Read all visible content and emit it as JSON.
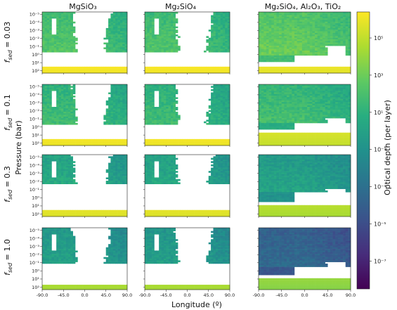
{
  "chart_data": {
    "type": "heatmap",
    "column_titles": [
      "MgSiO₃",
      "Mg₂SiO₄",
      "Mg₂SiO₄, Al₂O₃, TiO₂"
    ],
    "row_labels": [
      {
        "prefix": "f",
        "subscript": "sed",
        "suffix": " = 0.03"
      },
      {
        "prefix": "f",
        "subscript": "sed",
        "suffix": " = 0.1"
      },
      {
        "prefix": "f",
        "subscript": "sed",
        "suffix": " = 0.3"
      },
      {
        "prefix": "f",
        "subscript": "sed",
        "suffix": " = 1.0"
      }
    ],
    "xlabel": "Longitude (º)",
    "ylabel": "Pressure (bar)",
    "xlim": [
      -90,
      90
    ],
    "xticks": [
      "-90.0",
      "-45.0",
      "0.0",
      "45.0",
      "90.0"
    ],
    "ylim_log10": [
      -5.3,
      2.3
    ],
    "yticks": [
      "10⁻⁵",
      "10⁻⁴",
      "10⁻³",
      "10⁻²",
      "10⁻¹",
      "10⁰",
      "10¹",
      "10²"
    ],
    "colorbar": {
      "label": "Optical depth (per layer)",
      "scale": "log",
      "range_log10": [
        -8.5,
        6.4
      ],
      "ticks": [
        "10⁵",
        "10³",
        "10¹",
        "10⁻¹",
        "10⁻³",
        "10⁻⁵",
        "10⁻⁷"
      ],
      "colormap": "viridis"
    },
    "colormap_stops": [
      "#440154",
      "#472d7b",
      "#3b528b",
      "#2c728e",
      "#21918c",
      "#28ae80",
      "#5ec962",
      "#addc30",
      "#fde725"
    ],
    "panels": [
      {
        "row": 0,
        "col": 0,
        "upper_log_tau": 1.6,
        "bottom_log_tau": 6.3,
        "deep_band_log_p": [
          1.55,
          2.3
        ],
        "upper_cloud_bottom_log_p": -0.3,
        "vacant_nightside": true
      },
      {
        "row": 0,
        "col": 1,
        "upper_log_tau": 1.5,
        "bottom_log_tau": 6.3,
        "deep_band_log_p": [
          1.55,
          2.3
        ],
        "upper_cloud_bottom_log_p": -0.3,
        "vacant_nightside": true
      },
      {
        "row": 0,
        "col": 2,
        "upper_log_tau": 2.2,
        "bottom_log_tau": 6.0,
        "deep_band_log_p": [
          1.5,
          2.3
        ],
        "upper_cloud_bottom_log_p": 0.0,
        "vacant_nightside": false
      },
      {
        "row": 1,
        "col": 0,
        "upper_log_tau": 1.0,
        "bottom_log_tau": 6.2,
        "deep_band_log_p": [
          1.5,
          2.3
        ],
        "upper_cloud_bottom_log_p": -0.4,
        "vacant_nightside": true
      },
      {
        "row": 1,
        "col": 1,
        "upper_log_tau": 0.9,
        "bottom_log_tau": 6.2,
        "deep_band_log_p": [
          1.5,
          2.3
        ],
        "upper_cloud_bottom_log_p": -0.4,
        "vacant_nightside": true
      },
      {
        "row": 1,
        "col": 2,
        "upper_log_tau": 1.2,
        "bottom_log_tau": 5.5,
        "deep_band_log_p": [
          0.8,
          2.3
        ],
        "upper_cloud_bottom_log_p": -0.5,
        "vacant_nightside": false
      },
      {
        "row": 2,
        "col": 0,
        "upper_log_tau": 0.0,
        "bottom_log_tau": 5.8,
        "deep_band_log_p": [
          1.6,
          2.3
        ],
        "upper_cloud_bottom_log_p": -1.7,
        "vacant_nightside": true
      },
      {
        "row": 2,
        "col": 1,
        "upper_log_tau": -0.1,
        "bottom_log_tau": 5.8,
        "deep_band_log_p": [
          1.6,
          2.3
        ],
        "upper_cloud_bottom_log_p": -1.7,
        "vacant_nightside": true
      },
      {
        "row": 2,
        "col": 2,
        "upper_log_tau": -0.5,
        "bottom_log_tau": 4.8,
        "deep_band_log_p": [
          0.9,
          2.3
        ],
        "upper_cloud_bottom_log_p": -0.6,
        "vacant_nightside": false
      },
      {
        "row": 3,
        "col": 0,
        "upper_log_tau": -0.7,
        "bottom_log_tau": 4.5,
        "deep_band_log_p": [
          1.7,
          2.3
        ],
        "upper_cloud_bottom_log_p": -1.0,
        "vacant_nightside": true
      },
      {
        "row": 3,
        "col": 1,
        "upper_log_tau": -0.8,
        "bottom_log_tau": 4.5,
        "deep_band_log_p": [
          1.7,
          2.3
        ],
        "upper_cloud_bottom_log_p": -1.0,
        "vacant_nightside": true
      },
      {
        "row": 3,
        "col": 2,
        "upper_log_tau": -4.0,
        "bottom_log_tau": 4.0,
        "deep_band_log_p": [
          1.0,
          2.3
        ],
        "upper_cloud_bottom_log_p": -0.5,
        "vacant_nightside": false
      }
    ]
  }
}
